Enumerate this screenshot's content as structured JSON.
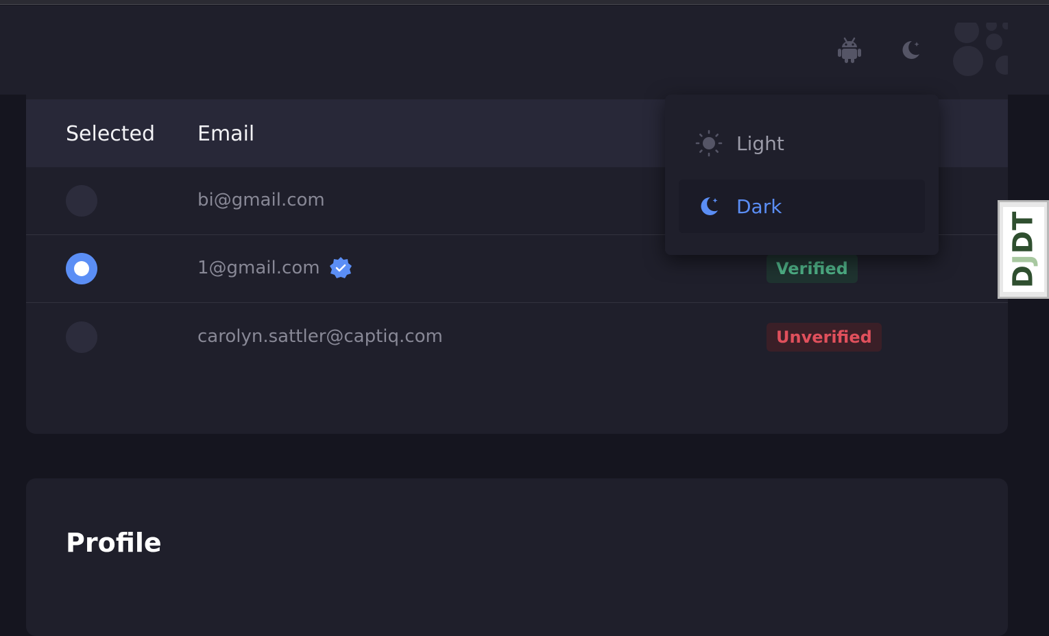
{
  "header": {
    "icons": [
      "android-icon",
      "moon-icon",
      "avatar"
    ]
  },
  "theme_menu": {
    "items": [
      {
        "label": "Light",
        "icon": "sun-icon"
      },
      {
        "label": "Dark",
        "icon": "moon-icon",
        "active": true
      }
    ]
  },
  "emails": {
    "columns": {
      "selected": "Selected",
      "email": "Email"
    },
    "rows": [
      {
        "email": "bi@gmail.com",
        "selected": false,
        "status": ""
      },
      {
        "email": "1@gmail.com",
        "selected": true,
        "verified_icon": true,
        "status": "Verified"
      },
      {
        "email": "carolyn.sattler@captiq.com",
        "selected": false,
        "status": "Unverified"
      }
    ]
  },
  "profile": {
    "title": "Profile"
  },
  "debug_toolbar": {
    "label_d": "D",
    "label_j": "J",
    "label_dt": "DT"
  },
  "colors": {
    "accent": "#5b8ef5",
    "verified": "#4eb086",
    "unverified": "#e0505c",
    "background": "#15151f",
    "surface": "#1f1f2b"
  }
}
